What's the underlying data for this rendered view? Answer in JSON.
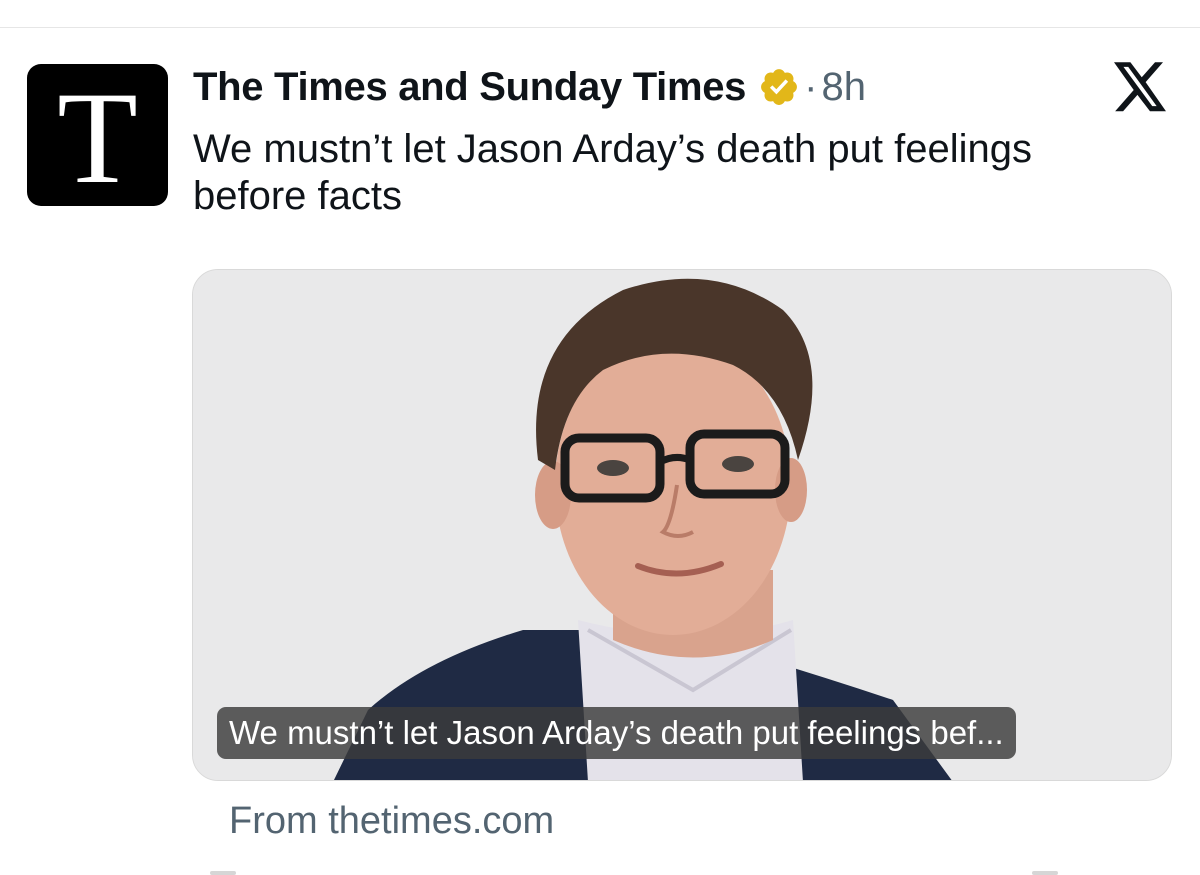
{
  "post": {
    "avatar_letter": "T",
    "account_name": "The Times and Sunday Times",
    "separator": "·",
    "timestamp": "8h",
    "headline": "We mustn’t let Jason Arday’s death put feelings before facts",
    "card": {
      "caption": "We mustn’t let Jason Arday’s death put feelings bef...",
      "source": "From thetimes.com"
    }
  },
  "icons": {
    "verified": "verified-badge-icon",
    "platform": "x-logo-icon"
  },
  "colors": {
    "avatar_bg": "#000000",
    "verified_gold": "#e2b719",
    "muted_text": "#536471",
    "card_bg": "#e9e9ea"
  }
}
